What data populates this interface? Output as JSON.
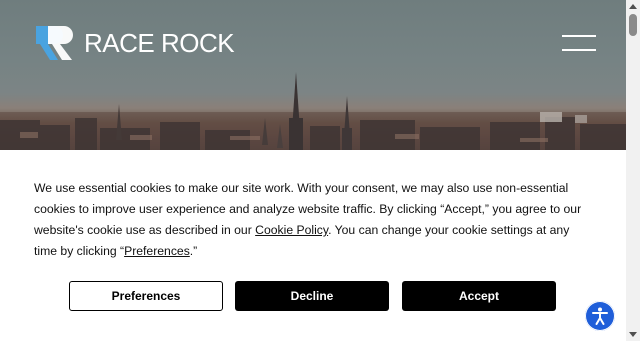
{
  "header": {
    "brand": "RACE ROCK",
    "logo_icon": "race-rock-r-logo",
    "menu_icon": "hamburger-menu-icon"
  },
  "cookie_banner": {
    "text_part1": "We use essential cookies to make our site work. With your consent, we may also use non-essential cookies to improve user experience and analyze website traffic. By clicking “Accept,” you agree to our website's cookie use as described in our ",
    "cookie_policy_link": "Cookie Policy",
    "text_part2": ". You can change your cookie settings at any time by clicking “",
    "preferences_link": "Preferences",
    "text_part3": ".”",
    "buttons": {
      "preferences": "Preferences",
      "decline": "Decline",
      "accept": "Accept"
    }
  },
  "accessibility": {
    "icon": "accessibility-icon"
  },
  "colors": {
    "accent_blue": "#1f5ed9",
    "logo_blue": "#4aa3e0",
    "button_dark": "#000000"
  }
}
